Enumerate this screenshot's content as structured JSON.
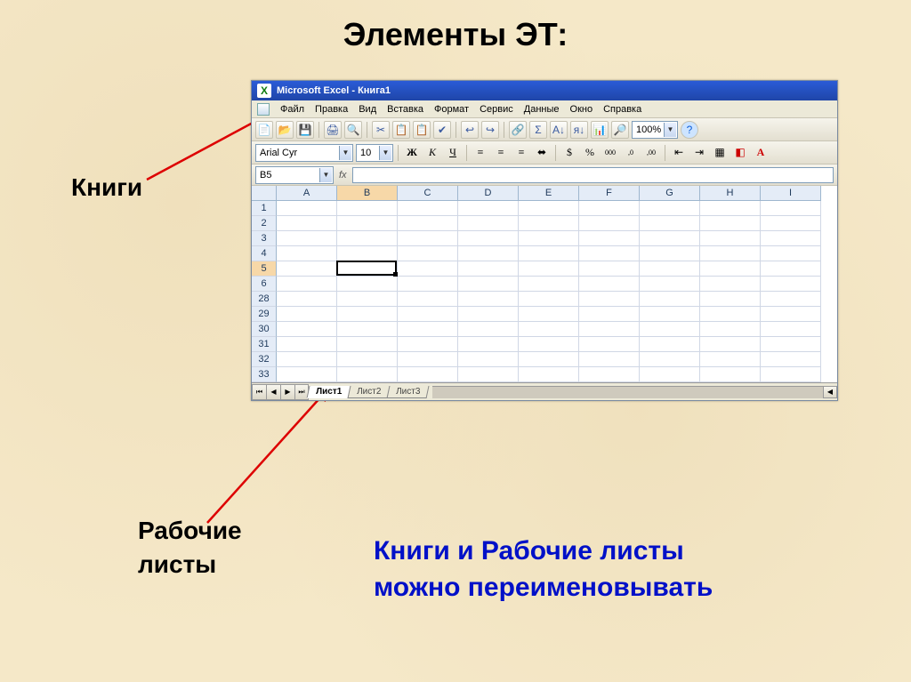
{
  "slide": {
    "title": "Элементы ЭТ:",
    "label_books": "Книги",
    "label_sheets_l1": "Рабочие",
    "label_sheets_l2": "листы",
    "note_l1": "Книги и Рабочие листы",
    "note_l2": "можно переименовывать"
  },
  "excel": {
    "title": "Microsoft Excel - Книга1",
    "menu": [
      "Файл",
      "Правка",
      "Вид",
      "Вставка",
      "Формат",
      "Сервис",
      "Данные",
      "Окно",
      "Справка"
    ],
    "font_name": "Arial Cyr",
    "font_size": "10",
    "zoom": "100%",
    "name_box": "B5",
    "fx_label": "fx",
    "columns": [
      "A",
      "B",
      "C",
      "D",
      "E",
      "F",
      "G",
      "H",
      "I"
    ],
    "rows": [
      "1",
      "2",
      "3",
      "4",
      "5",
      "6",
      "28",
      "29",
      "30",
      "31",
      "32",
      "33"
    ],
    "active_cell": {
      "col": "B",
      "row": "5",
      "col_index": 1,
      "row_index": 4
    },
    "sheets": [
      "Лист1",
      "Лист2",
      "Лист3"
    ],
    "active_sheet": 0,
    "fmt_buttons": {
      "bold": "Ж",
      "italic": "К",
      "underline": "Ч",
      "align_left": "≡",
      "align_center": "≡",
      "align_right": "≡",
      "merge": "⇔",
      "currency": "%",
      "percent": "%",
      "thousands": "000",
      "dec_inc": ",0",
      "dec_dec": ",00",
      "indent_dec": "⇤",
      "indent_inc": "⇥"
    },
    "toolbar_icons": [
      "📄",
      "📂",
      "💾",
      "🖨",
      "🔍",
      "✂",
      "📋",
      "📋",
      "✔",
      "↩",
      "↪",
      "🔗",
      "Σ",
      "A↓",
      "я↓",
      "📊",
      "🔎"
    ]
  }
}
